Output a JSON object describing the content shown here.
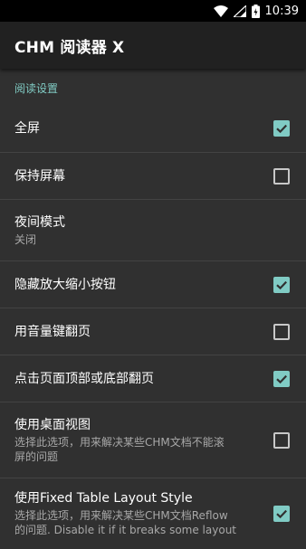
{
  "status_bar": {
    "time": "10:39",
    "icons": [
      "wifi-icon",
      "signal-icon",
      "battery-charging-icon"
    ]
  },
  "app_bar": {
    "title": "CHM 阅读器 X"
  },
  "category": {
    "title": "阅读设置"
  },
  "preferences": [
    {
      "label": "全屏",
      "checked": true
    },
    {
      "label": "保持屏幕",
      "checked": false
    },
    {
      "label": "夜间模式",
      "summary": "关闭"
    },
    {
      "label": "隐藏放大缩小按钮",
      "checked": true
    },
    {
      "label": "用音量键翻页",
      "checked": false
    },
    {
      "label": "点击页面顶部或底部翻页",
      "checked": true
    },
    {
      "label": "使用桌面视图",
      "summary_line1": "选择此选项，用来解决某些CHM文档不能滚",
      "summary_line2": "屏的问题",
      "checked": false
    },
    {
      "label": "使用Fixed Table Layout Style",
      "summary_line1": "选择此选项，用来解决某些CHM文档Reflow",
      "summary_line2": "的问题. Disable it if it breaks some layout",
      "checked": true
    }
  ],
  "colors": {
    "accent": "#80cbc4",
    "background": "#303030",
    "app_bar": "#212121"
  }
}
